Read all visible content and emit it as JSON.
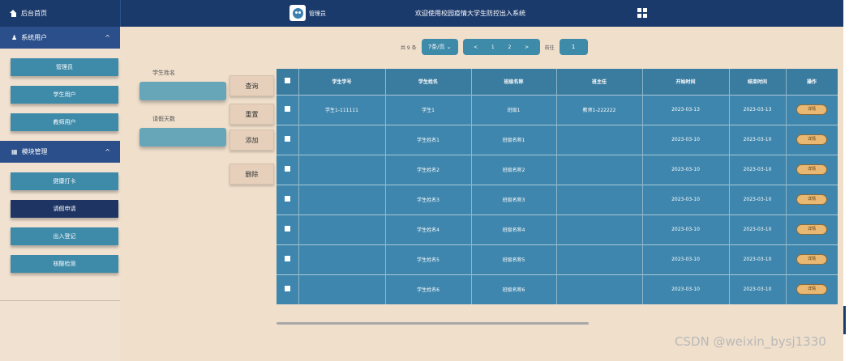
{
  "topbar": {
    "home_label": "后台首页",
    "role": "管理员",
    "title": "欢迎使用校园疫情大学生防控出入系统"
  },
  "sidebar": {
    "groups": [
      {
        "label": "系统用户",
        "items": [
          "管理员",
          "学生用户",
          "教师用户"
        ]
      },
      {
        "label": "模块管理",
        "items": [
          "健康打卡",
          "请假申请",
          "出入登记",
          "核酸检测"
        ]
      }
    ],
    "active_item": "请假申请"
  },
  "pager": {
    "total": "共 9 条",
    "page_size": "7条/页",
    "pages": [
      "<",
      "1",
      "2",
      ">"
    ],
    "goto_label": "前往",
    "goto_value": "1"
  },
  "search": {
    "name_label": "学生姓名",
    "days_label": "请假天数"
  },
  "actions": {
    "query": "查询",
    "reset": "重置",
    "add": "添加",
    "delete": "删除"
  },
  "table": {
    "headers": [
      "学生学号",
      "学生姓名",
      "班级名称",
      "班主任",
      "开始时间",
      "结束时间",
      "操作"
    ],
    "rows": [
      [
        "学生1-111111",
        "学生1",
        "班级1",
        "教师1-222222",
        "2023-03-13",
        "2023-03-13"
      ],
      [
        "",
        "学生姓名1",
        "班级名称1",
        "",
        "2023-03-10",
        "2023-03-10"
      ],
      [
        "",
        "学生姓名2",
        "班级名称2",
        "",
        "2023-03-10",
        "2023-03-10"
      ],
      [
        "",
        "学生姓名3",
        "班级名称3",
        "",
        "2023-03-10",
        "2023-03-10"
      ],
      [
        "",
        "学生姓名4",
        "班级名称4",
        "",
        "2023-03-10",
        "2023-03-10"
      ],
      [
        "",
        "学生姓名5",
        "班级名称5",
        "",
        "2023-03-10",
        "2023-03-10"
      ],
      [
        "",
        "学生姓名6",
        "班级名称6",
        "",
        "2023-03-10",
        "2023-03-10"
      ]
    ],
    "detail_label": "详情"
  },
  "watermark": "CSDN @weixin_bysj1330"
}
